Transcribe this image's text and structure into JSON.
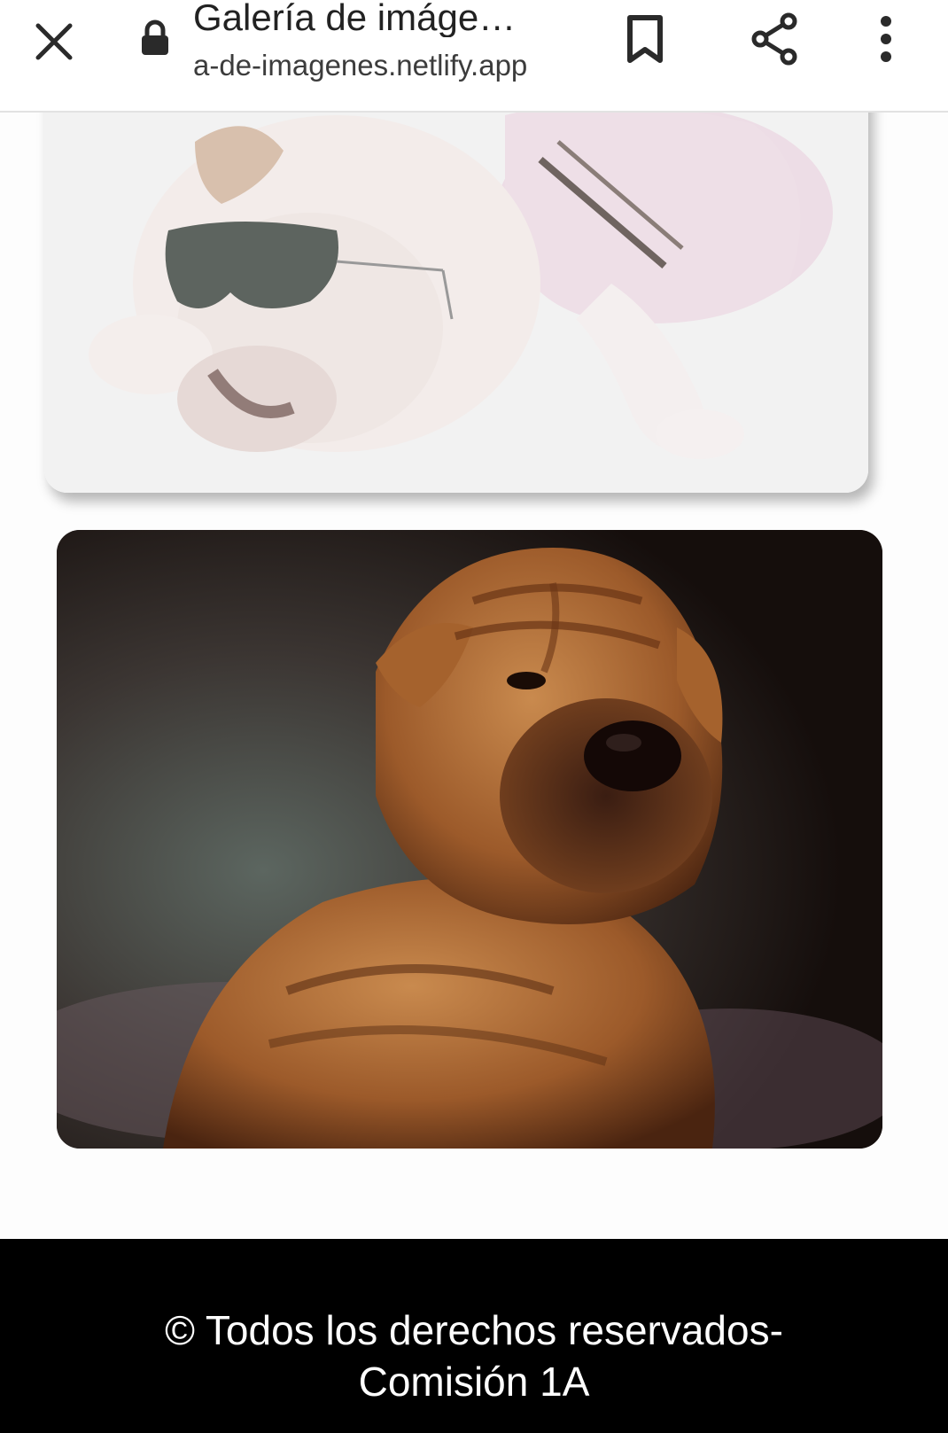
{
  "browser": {
    "page_title": "Galería de imáge…",
    "url": "a-de-imagenes.netlify.app",
    "icons": {
      "close": "close-icon",
      "lock": "lock-icon",
      "bookmark": "bookmark-icon",
      "share": "share-icon",
      "more": "more-vertical-icon"
    }
  },
  "gallery": {
    "images": [
      {
        "subject": "bulldog-with-sunglasses-photo"
      },
      {
        "subject": "shar-pei-puppy-photo"
      }
    ]
  },
  "footer": {
    "line1": "© Todos los derechos reservados-",
    "line2": "Comisión 1A"
  },
  "colors": {
    "toolbar_bg": "#ffffff",
    "footer_bg": "#000000",
    "footer_text": "#ffffff"
  }
}
